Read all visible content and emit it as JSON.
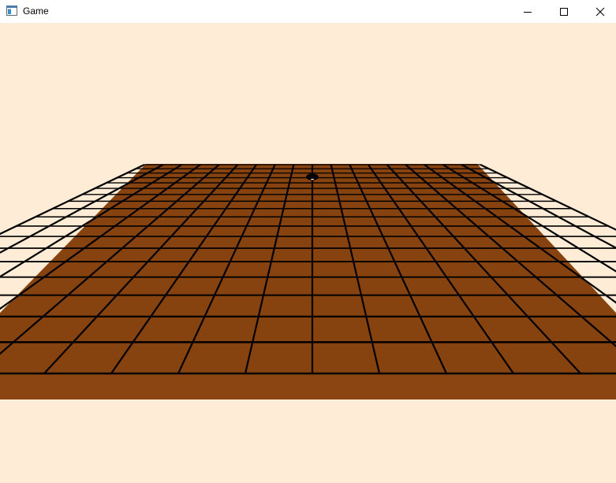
{
  "window": {
    "title": "Game",
    "icon": "app-window-icon",
    "controls": {
      "minimize_icon": "minimize-icon",
      "maximize_icon": "maximize-icon",
      "close_icon": "close-icon"
    }
  },
  "scene": {
    "background_color": "#ffecd6",
    "board_color": "#8b4513",
    "board_top_color": "#86420f",
    "board_edge_color": "#8a4513",
    "line_color": "#000000",
    "grid_size": 19,
    "stones": [
      {
        "color": "black",
        "col": 9,
        "row": 3
      }
    ]
  }
}
